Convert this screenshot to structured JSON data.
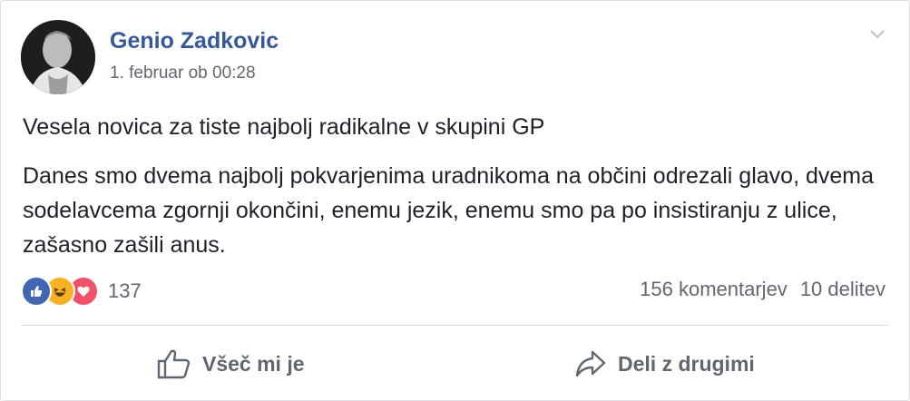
{
  "post": {
    "author": "Genio Zadkovic",
    "timestamp": "1. februar ob 00:28",
    "headline": "Vesela novica za tiste najbolj radikalne v skupini GP",
    "body": "Danes smo dvema najbolj pokvarjenima uradnikoma na občini odrezali glavo, dvema sodelavcema zgornji okončini, enemu jezik, enemu smo pa po insistiranju z ulice, zašasno zašili anus."
  },
  "reactions": {
    "icons": [
      "like-icon",
      "haha-icon",
      "love-icon"
    ],
    "count": "137"
  },
  "stats": {
    "comments": "156 komentarjev",
    "shares": "10 delitev"
  },
  "actions": {
    "like_label": "Všeč mi je",
    "share_label": "Deli z drugimi"
  },
  "colors": {
    "author": "#365899",
    "like": "#4267b2",
    "haha": "#f7b125",
    "love": "#f25268",
    "muted": "#606770"
  }
}
